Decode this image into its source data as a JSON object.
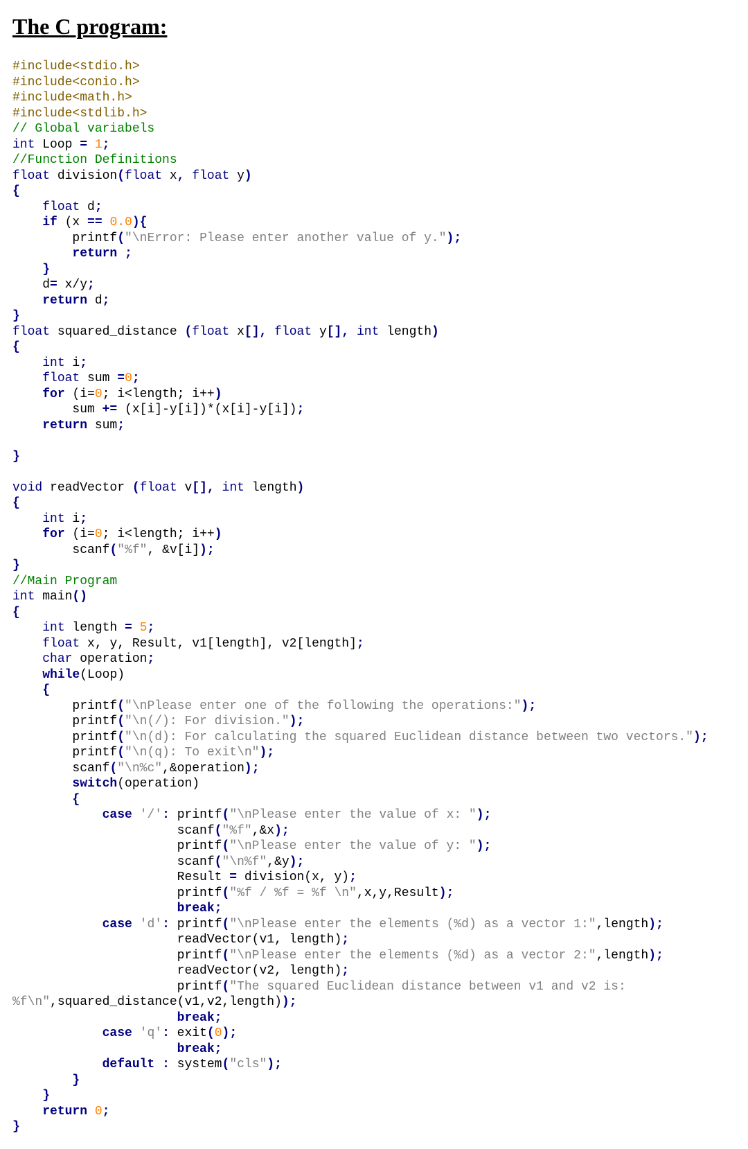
{
  "title": "The C program:",
  "code": {
    "inc1": "#include<stdio.h>",
    "inc2": "#include<conio.h>",
    "inc3": "#include<math.h>",
    "inc4": "#include<stdlib.h>",
    "cmt_globals": "// Global variabels",
    "t_int": "int",
    "loop_decl": " Loop ",
    "eq": "=",
    "one": "1",
    "semi": ";",
    "cmt_fndefs": "//Function Definitions",
    "t_float": "float",
    "fn_div": " division",
    "lp": "(",
    "rp": ")",
    "x": " x",
    "comma": ",",
    "y": " y",
    "lb": "{",
    "rb": "}",
    "d_decl": " d",
    "kw_if": "if",
    "cond_x_eq": " (x ",
    "eqeq": "==",
    "zero_f": " 0.0",
    "rp_lb": "){",
    "printf": "printf",
    "str_err": "\"\\nError: Please enter another value of y.\"",
    "kw_return": "return",
    "ret_sp": " ",
    "d_assign": "    d",
    "assign": "=",
    "xdy": " x/y",
    "ret_d": " d",
    "fn_sqd": " squared_distance ",
    "xarr": " x",
    "brackets": "[]",
    "yarr": " y",
    "len_param": " length",
    "i_decl": " i",
    "sum_decl": " sum ",
    "zero": "0",
    "kw_for": "for",
    "for_head_open": " (i=",
    "for_head_mid": "; i<length; i++",
    "for_head_close": ")",
    "sum_pe": "        sum ",
    "pe": "+=",
    "sqd_expr": " (x[i]-y[i])*(x[i]-y[i])",
    "ret_sum": " sum",
    "t_void": "void",
    "fn_readv": " readVector ",
    "varr": " v",
    "scanf": "scanf",
    "str_pf": "\"%f\"",
    "amp_vi": ", &v[i]",
    "cmt_main": "//Main Program",
    "fn_main": " main",
    "empty_parens": "()",
    "len_decl": " length ",
    "five": "5",
    "xy_res": " x, y, Result, v1[length], v2[length]",
    "t_char": "char",
    "op_decl": " operation",
    "kw_while": "while",
    "while_arg": "(Loop)",
    "str_menu1": "\"\\nPlease enter one of the following the operations:\"",
    "str_menu2": "\"\\n(/): For division.\"",
    "str_menu3": "\"\\n(d): For calculating the squared Euclidean distance between two vectors.\"",
    "str_menu4": "\"\\n(q): To exit\\n\"",
    "str_scanop": "\"\\n%c\"",
    "amp_op": ",&operation",
    "kw_switch": "switch",
    "sw_arg": "(operation)",
    "kw_case": "case",
    "ch_slash": " '/'",
    "colon": ":",
    "str_enterx": "\"\\nPlease enter the value of x: \"",
    "str_pctf": "\"%f\"",
    "amp_x": ",&x",
    "str_entery": "\"\\nPlease enter the value of y: \"",
    "str_nl_pctf": "\"\\n%f\"",
    "amp_y": ",&y",
    "res_assign": "Result ",
    "div_call": " division(x, y)",
    "str_divout": "\"%f / %f = %f \\n\"",
    "divout_args": ",x,y,Result",
    "kw_break": "break",
    "ch_d": " 'd'",
    "str_vec1": "\"\\nPlease enter the elements (%d) as a vector 1:\"",
    "len_arg": ",length",
    "rv_call1": "readVector(v1, length)",
    "str_vec2": "\"\\nPlease enter the elements (%d) as a vector 2:\"",
    "rv_call2": "readVector(v2, length)",
    "str_sqdout1": "\"The squared Euclidean distance between v1 and v2 is:",
    "str_sqdout2": "%f\\n\"",
    "sqd_call": ",squared_distance(v1,v2,length)",
    "ch_q": " 'q'",
    "exit_call": " exit",
    "kw_default": "default",
    "sys_call": " system",
    "str_cls": "\"cls\"",
    "ret_zero": " 0"
  }
}
